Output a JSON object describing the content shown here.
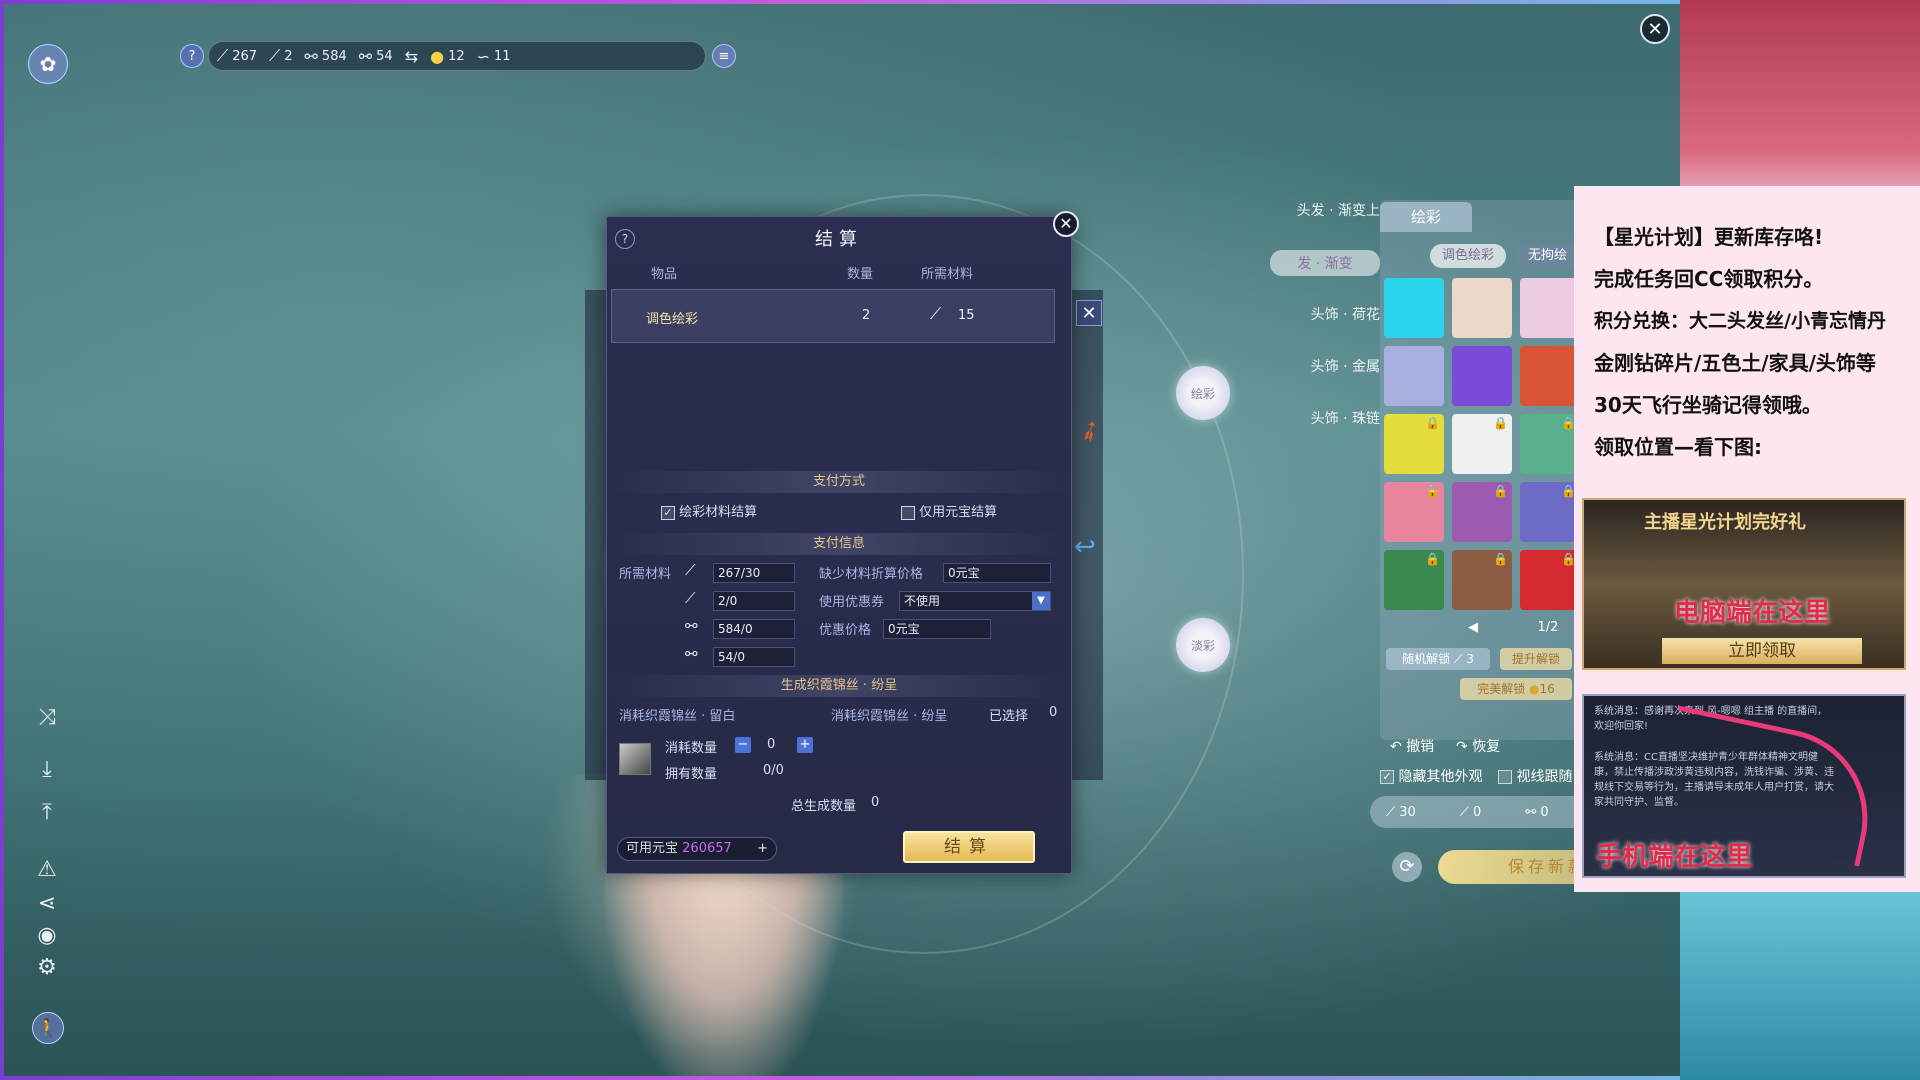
{
  "topbar": {
    "help": "?",
    "resources": [
      {
        "icon": "brush-icon",
        "value": "267"
      },
      {
        "icon": "brush-icon",
        "value": "2"
      },
      {
        "icon": "comb-icon",
        "value": "584"
      },
      {
        "icon": "comb-icon",
        "value": "54"
      },
      {
        "icon": "yuanbao-icon",
        "value": "12"
      },
      {
        "icon": "thread-icon",
        "value": "11"
      }
    ]
  },
  "categories": [
    "头发 · 渐变上",
    "发 · 渐变",
    "头饰 · 荷花",
    "头饰 · 金属",
    "头饰 · 珠链"
  ],
  "petals": {
    "paint": "绘彩",
    "fade": "淡彩"
  },
  "palette": {
    "tab": "绘彩",
    "seg_active": "调色绘彩",
    "seg_other": "无拘绘",
    "page": "1/2",
    "random_unlock": "随机解锁",
    "random_cost": "3",
    "upgrade_unlock": "提升解锁",
    "perfect_unlock": "完美解锁",
    "perfect_cost": "16",
    "undo": "撤销",
    "redo": "恢复",
    "hide_others": "隐藏其他外观",
    "follow_view": "视线跟随",
    "mat_values": [
      "30",
      "0",
      "0"
    ],
    "save": "保存新款式"
  },
  "dialog": {
    "title": "结算",
    "help": "?",
    "headers": {
      "item": "物品",
      "qty": "数量",
      "materials": "所需材料"
    },
    "row": {
      "item": "调色绘彩",
      "qty": "2",
      "mat": "15"
    },
    "payment_section": "支付方式",
    "pay_material": "绘彩材料结算",
    "pay_yuanbao": "仅用元宝结算",
    "info_section": "支付信息",
    "required_label": "所需材料",
    "materials": [
      "267/30",
      "2/0",
      "584/0",
      "54/0"
    ],
    "missing_label": "缺少材料折算价格",
    "missing_value": "0元宝",
    "coupon_label": "使用优惠券",
    "coupon_value": "不使用",
    "discount_label": "优惠价格",
    "discount_value": "0元宝",
    "gen_section": "生成织霞锦丝 · 纷呈",
    "consume_white": "消耗织霞锦丝 · 留白",
    "consume_color": "消耗织霞锦丝 · 纷呈",
    "selected_label": "已选择",
    "selected_value": "0",
    "consume_qty_label": "消耗数量",
    "consume_qty_value": "0",
    "owned_label": "拥有数量",
    "owned_value": "0/0",
    "total_label": "总生成数量",
    "total_value": "0",
    "yuanbao_label": "可用元宝",
    "yuanbao_value": "260657",
    "settle_button": "结算"
  },
  "ad": {
    "lines": [
      "【星光计划】更新库存咯!",
      "完成任务回CC领取积分。",
      "积分兑换：大二头发丝/小青忘情丹",
      "金刚钻碎片/五色土/家具/头饰等",
      "30天飞行坐骑记得领哦。",
      "领取位置—看下图:"
    ],
    "img1_title": "主播星光计划完好礼",
    "img1_red": "电脑端在这里",
    "img1_cta": "立即领取",
    "img2_msg1": "系统消息：感谢再次来到 风-嗯嗯 组主播 的直播间，欢迎你回家!",
    "img2_msg2": "系统消息：CC直播坚决维护青少年群体精神文明健康，禁止传播涉政涉黄违规内容，洗钱诈骗、涉黄、违规线下交易等行为，主播请导未成年人用户打赏，请大家共同守护、监督。",
    "img2_red": "手机端在这里"
  }
}
